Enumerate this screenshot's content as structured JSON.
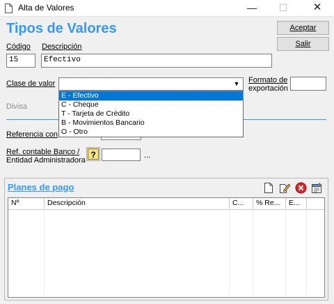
{
  "window": {
    "title": "Alta de Valores"
  },
  "header": {
    "title": "Tipos de Valores"
  },
  "buttons": {
    "accept": "Aceptar",
    "exit": "Salir"
  },
  "form": {
    "codigo_label": "Código",
    "codigo_value": "15",
    "descripcion_label": "Descripción",
    "descripcion_value": "Efectivo",
    "clase_label": "Clase de valor",
    "clase_value": "",
    "formato_label_line1": "Formato de",
    "formato_label_line2": "exportación",
    "divisa_label": "Divisa",
    "referencia_label": "Referencia con",
    "ref_banco_line1": "Ref. contable Banco /",
    "ref_banco_line2": "Entidad Administradora",
    "ellipsis": "..."
  },
  "dropdown": {
    "options": [
      "E - Efectivo",
      "C - Cheque",
      "T - Tarjeta de Crédito",
      "B - Movimientos Bancario",
      "O - Otro"
    ],
    "selected_index": 0
  },
  "planes": {
    "title": "Planes de pago",
    "columns": [
      "Nº",
      "Descripción",
      "C...",
      "% Re...",
      "E..."
    ]
  },
  "colors": {
    "accent": "#3399ff",
    "selection": "#0078d7",
    "delete": "#d9272e"
  }
}
